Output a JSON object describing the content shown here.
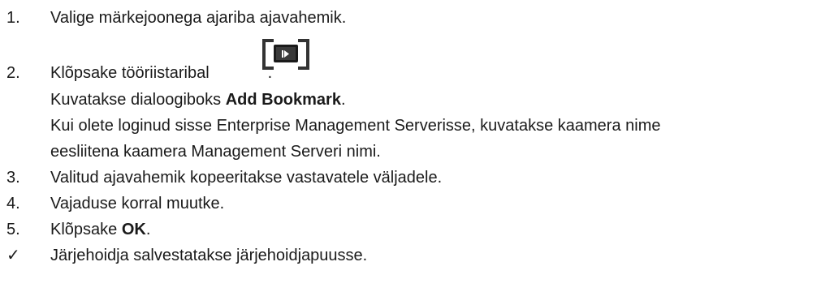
{
  "steps": [
    {
      "number": "1.",
      "text": "Valige märkejoonega ajariba ajavahemik."
    },
    {
      "number": "2.",
      "text_before_icon": "Klõpsake tööriistaribal",
      "text_after_icon": "."
    },
    {
      "number": "3.",
      "text": "Valitud ajavahemik kopeeritakse vastavatele väljadele."
    },
    {
      "number": "4.",
      "text": "Vajaduse korral muutke."
    },
    {
      "number": "5.",
      "text_before": "Klõpsake ",
      "bold": "OK",
      "text_after": "."
    }
  ],
  "step2_details": {
    "line1_before": "Kuvatakse dialoogiboks ",
    "line1_bold": "Add Bookmark",
    "line1_after": ".",
    "line2": "Kui olete loginud sisse Enterprise Management Serverisse, kuvatakse kaamera nime",
    "line3": "eesliitena kaamera Management Serveri nimi."
  },
  "result": {
    "marker": "✓",
    "text": "Järjehoidja salvestatakse järjehoidjapuusse."
  },
  "icons": {
    "toolbar_icon": "add-bookmark-icon"
  }
}
